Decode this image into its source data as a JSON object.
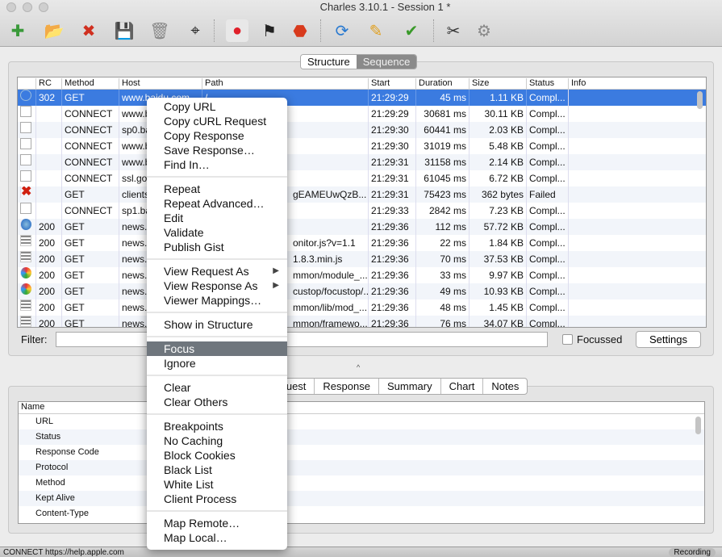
{
  "window": {
    "title": "Charles 3.10.1 - Session 1 *"
  },
  "toolbar": [
    {
      "icon": "new-session-icon",
      "glyph": "✚",
      "color": "#3a9a3a"
    },
    {
      "icon": "open-folder-icon",
      "glyph": "📂",
      "color": "#2a6fc9"
    },
    {
      "icon": "close-session-icon",
      "glyph": "✖",
      "color": "#d03020"
    },
    {
      "icon": "save-icon",
      "glyph": "💾",
      "color": "#222"
    },
    {
      "icon": "trash-icon",
      "glyph": "🗑",
      "color": "#888"
    },
    {
      "icon": "binoculars-icon",
      "glyph": "⌖",
      "color": "#222"
    },
    {
      "icon": "record-icon",
      "glyph": "●",
      "color": "#e0202a"
    },
    {
      "icon": "throttle-flag-icon",
      "glyph": "⚑",
      "color": "#222"
    },
    {
      "icon": "stop-icon",
      "glyph": "⬣",
      "color": "#d83a1c"
    },
    {
      "icon": "repeat-icon",
      "glyph": "⟳",
      "color": "#2a7ad0"
    },
    {
      "icon": "edit-pencil-icon",
      "glyph": "✎",
      "color": "#e0a020"
    },
    {
      "icon": "validate-check-icon",
      "glyph": "✔",
      "color": "#3a9a2a"
    },
    {
      "icon": "tools-icon",
      "glyph": "✂",
      "color": "#333"
    },
    {
      "icon": "settings-gear-icon",
      "glyph": "⚙",
      "color": "#888"
    }
  ],
  "view_toggle": {
    "structure": "Structure",
    "sequence": "Sequence",
    "selected": "Sequence"
  },
  "table": {
    "columns": [
      "RC",
      "Method",
      "Host",
      "Path",
      "Start",
      "Duration",
      "Size",
      "Status",
      "Info"
    ],
    "rows": [
      {
        "icon": "redirect",
        "rc": "302",
        "method": "GET",
        "host": "www.baidu.com",
        "path": "/",
        "start": "21:29:29",
        "duration": "45 ms",
        "size": "1.11 KB",
        "status": "Compl..."
      },
      {
        "icon": "doc",
        "rc": "",
        "method": "CONNECT",
        "host": "www.b",
        "path": "",
        "start": "21:29:29",
        "duration": "30681 ms",
        "size": "30.11 KB",
        "status": "Compl..."
      },
      {
        "icon": "doc",
        "rc": "",
        "method": "CONNECT",
        "host": "sp0.ba",
        "path": "",
        "start": "21:29:30",
        "duration": "60441 ms",
        "size": "2.03 KB",
        "status": "Compl..."
      },
      {
        "icon": "doc",
        "rc": "",
        "method": "CONNECT",
        "host": "www.b",
        "path": "",
        "start": "21:29:30",
        "duration": "31019 ms",
        "size": "5.48 KB",
        "status": "Compl..."
      },
      {
        "icon": "doc",
        "rc": "",
        "method": "CONNECT",
        "host": "www.b",
        "path": "",
        "start": "21:29:31",
        "duration": "31158 ms",
        "size": "2.14 KB",
        "status": "Compl..."
      },
      {
        "icon": "doc",
        "rc": "",
        "method": "CONNECT",
        "host": "ssl.go",
        "path": "",
        "start": "21:29:31",
        "duration": "61045 ms",
        "size": "6.72 KB",
        "status": "Compl..."
      },
      {
        "icon": "failed",
        "rc": "",
        "method": "GET",
        "host": "clients",
        "path": "gEAMEUwQzB...",
        "start": "21:29:31",
        "duration": "75423 ms",
        "size": "362 bytes",
        "status": "Failed"
      },
      {
        "icon": "doc",
        "rc": "",
        "method": "CONNECT",
        "host": "sp1.ba",
        "path": "",
        "start": "21:29:33",
        "duration": "2842 ms",
        "size": "7.23 KB",
        "status": "Compl..."
      },
      {
        "icon": "html",
        "rc": "200",
        "method": "GET",
        "host": "news.",
        "path": "",
        "start": "21:29:36",
        "duration": "112 ms",
        "size": "57.72 KB",
        "status": "Compl..."
      },
      {
        "icon": "script",
        "rc": "200",
        "method": "GET",
        "host": "news.",
        "path": "onitor.js?v=1.1",
        "start": "21:29:36",
        "duration": "22 ms",
        "size": "1.84 KB",
        "status": "Compl..."
      },
      {
        "icon": "script",
        "rc": "200",
        "method": "GET",
        "host": "news.",
        "path": "1.8.3.min.js",
        "start": "21:29:36",
        "duration": "70 ms",
        "size": "37.53 KB",
        "status": "Compl..."
      },
      {
        "icon": "css",
        "rc": "200",
        "method": "GET",
        "host": "news.",
        "path": "mmon/module_...",
        "start": "21:29:36",
        "duration": "33 ms",
        "size": "9.97 KB",
        "status": "Compl..."
      },
      {
        "icon": "css",
        "rc": "200",
        "method": "GET",
        "host": "news.",
        "path": "custop/focustop/...",
        "start": "21:29:36",
        "duration": "49 ms",
        "size": "10.93 KB",
        "status": "Compl..."
      },
      {
        "icon": "script",
        "rc": "200",
        "method": "GET",
        "host": "news.",
        "path": "mmon/lib/mod_...",
        "start": "21:29:36",
        "duration": "48 ms",
        "size": "1.45 KB",
        "status": "Compl..."
      },
      {
        "icon": "script",
        "rc": "200",
        "method": "GET",
        "host": "news.",
        "path": "mmon/framewo...",
        "start": "21:29:36",
        "duration": "76 ms",
        "size": "34.07 KB",
        "status": "Compl..."
      }
    ]
  },
  "filter": {
    "label": "Filter:",
    "value": "",
    "focussed_label": "Focussed",
    "focussed_checked": false,
    "settings": "Settings"
  },
  "detail_tabs": [
    "Request",
    "Response",
    "Summary",
    "Chart",
    "Notes"
  ],
  "detail_table": {
    "header": "Name",
    "rows": [
      "URL",
      "Status",
      "Response Code",
      "Protocol",
      "Method",
      "Kept Alive",
      "Content-Type"
    ]
  },
  "context_menu": {
    "groups": [
      [
        "Copy URL",
        "Copy cURL Request",
        "Copy Response",
        "Save Response…",
        "Find In…"
      ],
      [
        "Repeat",
        "Repeat Advanced…",
        "Edit",
        "Validate",
        "Publish Gist"
      ],
      [
        "View Request As",
        "View Response As",
        "Viewer Mappings…"
      ],
      [
        "Show in Structure"
      ],
      [
        "Focus",
        "Ignore"
      ],
      [
        "Clear",
        "Clear Others"
      ],
      [
        "Breakpoints",
        "No Caching",
        "Block Cookies",
        "Black List",
        "White List",
        "Client Process"
      ],
      [
        "Map Remote…",
        "Map Local…"
      ]
    ],
    "highlighted": "Focus",
    "submenus": [
      "View Request As",
      "View Response As"
    ]
  },
  "statusbar": {
    "text": "CONNECT https://help.apple.com",
    "recording": "Recording"
  },
  "colors": {
    "selection": "#3b7be0",
    "menu_highlight": "#6f767d"
  }
}
